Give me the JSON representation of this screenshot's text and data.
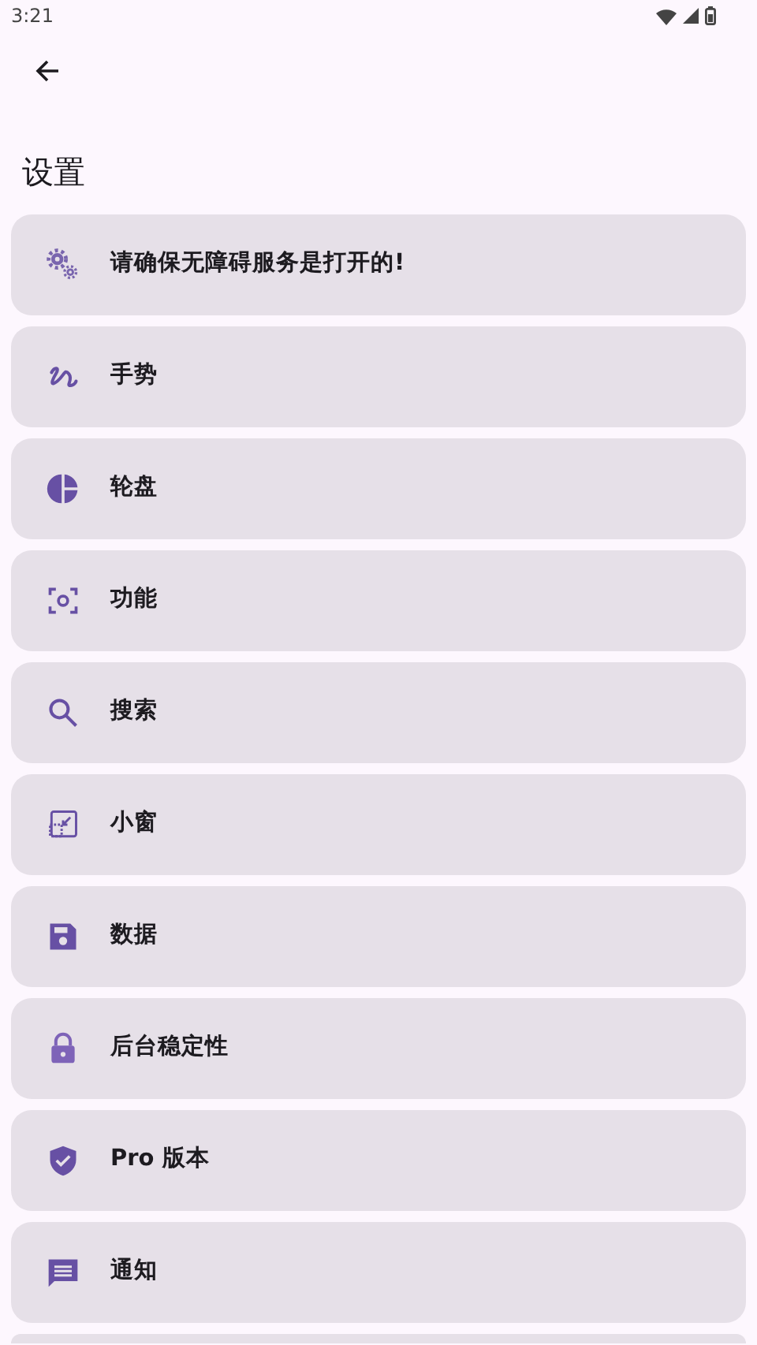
{
  "status_bar": {
    "time": "3:21"
  },
  "title": "设置",
  "items": [
    {
      "label": "请确保无障碍服务是打开的!"
    },
    {
      "label": "手势"
    },
    {
      "label": "轮盘"
    },
    {
      "label": "功能"
    },
    {
      "label": "搜索"
    },
    {
      "label": "小窗"
    },
    {
      "label": "数据"
    },
    {
      "label": "后台稳定性"
    },
    {
      "label": "Pro 版本"
    },
    {
      "label": "通知"
    }
  ]
}
